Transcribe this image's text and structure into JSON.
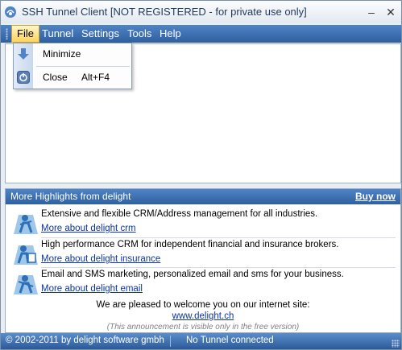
{
  "window": {
    "title": "SSH Tunnel Client [NOT REGISTERED - for private use only]",
    "minimize_glyph": "–",
    "close_glyph": "✕"
  },
  "menubar": {
    "items": [
      {
        "label": "File",
        "active": true
      },
      {
        "label": "Tunnel"
      },
      {
        "label": "Settings"
      },
      {
        "label": "Tools"
      },
      {
        "label": "Help"
      }
    ]
  },
  "file_menu": {
    "items": [
      {
        "label": "Minimize",
        "shortcut": "",
        "icon": "minimize-down-arrow-icon"
      },
      {
        "label": "Close",
        "shortcut": "Alt+F4",
        "icon": "close-power-icon"
      }
    ]
  },
  "highlights": {
    "title": "More Highlights from delight",
    "buy_now": "Buy now",
    "items": [
      {
        "text": "Extensive and flexible CRM/Address management for all industries.",
        "link": "More about delight crm",
        "icon": "crm-figure-icon"
      },
      {
        "text": "High performance CRM for independent financial and insurance brokers.",
        "link": "More about delight insurance",
        "icon": "insurance-figure-icon"
      },
      {
        "text": "Email and SMS marketing, personalized email and sms for your business.",
        "link": "More about delight email",
        "icon": "email-figure-icon"
      }
    ],
    "welcome": "We are pleased to welcome you on our internet site:",
    "site_link": "www.delight.ch",
    "note": "(This announcement is visible only in the free version)"
  },
  "statusbar": {
    "copyright": "© 2002-2011 by delight software gmbh",
    "connection": "No Tunnel connected"
  },
  "colors": {
    "accent": "#2f5f9f",
    "menu_active": "#ffd35a",
    "link": "#0b34a8"
  }
}
